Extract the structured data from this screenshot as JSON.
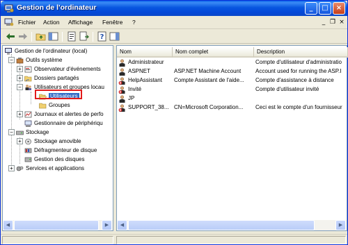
{
  "window": {
    "title": "Gestion de l'ordinateur",
    "controls": {
      "minimize": "_",
      "maximize": "□",
      "close": "×"
    }
  },
  "menu": [
    "Fichier",
    "Action",
    "Affichage",
    "Fenêtre",
    "?"
  ],
  "mdi_controls": {
    "minimize": "_",
    "restore": "❐",
    "close": "×"
  },
  "tree": {
    "root": "Gestion de l'ordinateur (local)",
    "system_tools": "Outils système",
    "event_viewer": "Observateur d'événements",
    "shared_folders": "Dossiers partagés",
    "local_users": "Utilisateurs et groupes locau",
    "users": "Utilisateurs",
    "groups": "Groupes",
    "perf_logs": "Journaux et alertes de perfo",
    "device_manager": "Gestionnaire de périphériqu",
    "storage": "Stockage",
    "removable": "Stockage amovible",
    "defrag": "Défragmenteur de disque",
    "disk_mgmt": "Gestion des disques",
    "services": "Services et applications"
  },
  "list": {
    "headers": {
      "name": "Nom",
      "fullname": "Nom complet",
      "description": "Description"
    },
    "rows": [
      {
        "name": "Administrateur",
        "fullname": "",
        "description": "Compte d'utilisateur d'administratio",
        "disabled": false
      },
      {
        "name": "ASPNET",
        "fullname": "ASP.NET Machine Account",
        "description": "Account used for running the ASP.I",
        "disabled": false
      },
      {
        "name": "HelpAssistant",
        "fullname": "Compte Assistant de l'aide...",
        "description": "Compte d'assistance à distance",
        "disabled": true
      },
      {
        "name": "Invité",
        "fullname": "",
        "description": "Compte d'utilisateur invité",
        "disabled": true
      },
      {
        "name": "JP",
        "fullname": "",
        "description": "",
        "disabled": false
      },
      {
        "name": "SUPPORT_38...",
        "fullname": "CN=Microsoft Corporation...",
        "description": "Ceci est le compte d'un fournisseur",
        "disabled": true
      }
    ]
  },
  "colors": {
    "title_blue": "#0a5fea",
    "selection": "#316ac5",
    "highlight_box": "#e21b1b"
  }
}
